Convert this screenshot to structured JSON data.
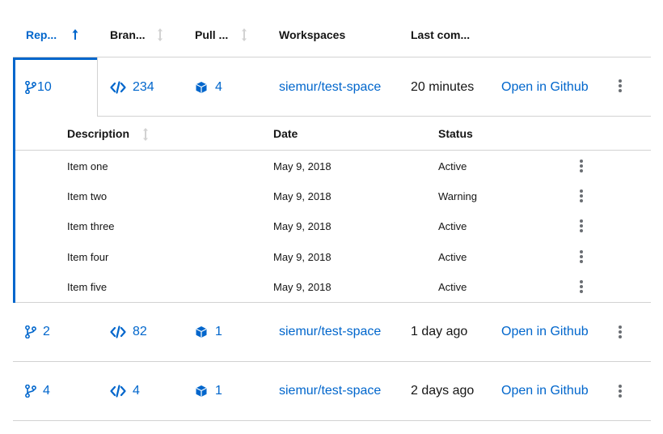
{
  "columns": {
    "repositories": "Rep...",
    "branches": "Bran...",
    "pull_requests": "Pull ...",
    "workspaces": "Workspaces",
    "last_commit": "Last com..."
  },
  "rows": [
    {
      "repositories": "10",
      "branches": "234",
      "pull_requests": "4",
      "workspace": "siemur/test-space",
      "last_commit": "20 minutes",
      "action": "Open in Github",
      "expanded": true
    },
    {
      "repositories": "2",
      "branches": "82",
      "pull_requests": "1",
      "workspace": "siemur/test-space",
      "last_commit": "1 day ago",
      "action": "Open in Github",
      "expanded": false
    },
    {
      "repositories": "4",
      "branches": "4",
      "pull_requests": "1",
      "workspace": "siemur/test-space",
      "last_commit": "2 days ago",
      "action": "Open in Github",
      "expanded": false
    }
  ],
  "nested": {
    "columns": {
      "description": "Description",
      "date": "Date",
      "status": "Status"
    },
    "rows": [
      {
        "description": "Item one",
        "date": "May 9, 2018",
        "status": "Active"
      },
      {
        "description": "Item two",
        "date": "May 9, 2018",
        "status": "Warning"
      },
      {
        "description": "Item three",
        "date": "May 9, 2018",
        "status": "Active"
      },
      {
        "description": "Item four",
        "date": "May 9, 2018",
        "status": "Active"
      },
      {
        "description": "Item five",
        "date": "May 9, 2018",
        "status": "Active"
      }
    ]
  },
  "colors": {
    "accent": "#0066cc",
    "border": "#d2d2d2",
    "text": "#151515",
    "sort_inactive": "#d2d2d2",
    "kebab": "#6a6e73"
  },
  "icons": [
    "code-branch-icon",
    "code-icon",
    "cube-icon",
    "sort-ascending-icon",
    "sort-icon",
    "kebab-icon"
  ]
}
